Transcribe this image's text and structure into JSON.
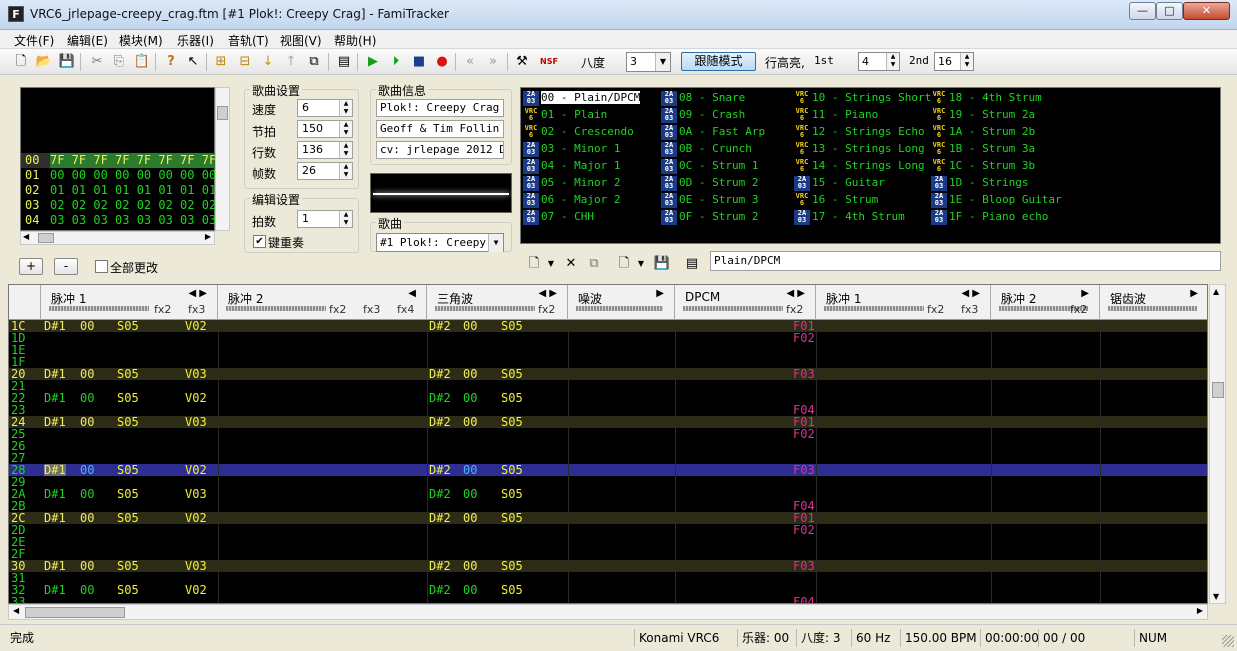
{
  "window": {
    "title": "VRC6_jrlepage-creepy_crag.ftm [#1 Plok!: Creepy Crag] - FamiTracker",
    "min_glyph": "—",
    "max_glyph": "□",
    "close_glyph": "✕"
  },
  "menu": [
    "文件(F)",
    "编辑(E)",
    "模块(M)",
    "乐器(I)",
    "音轨(T)",
    "视图(V)",
    "帮助(H)"
  ],
  "toolbar": {
    "octave_label": "八度",
    "octave_value": "3",
    "follow_label": "跟随模式",
    "row_highlight_label": "行高亮,",
    "first_label": "1st",
    "first_value": "4",
    "second_label": "2nd",
    "second_value": "16"
  },
  "frames": {
    "rows": [
      {
        "num": "00",
        "values": "7F 7F 7F 7F 7F 7F 7F 7F"
      },
      {
        "num": "01",
        "values": "00 00 00 00 00 00 00 00"
      },
      {
        "num": "02",
        "values": "01 01 01 01 01 01 01 01"
      },
      {
        "num": "03",
        "values": "02 02 02 02 02 02 02 02"
      },
      {
        "num": "04",
        "values": "03 03 03 03 03 03 03 03"
      }
    ],
    "add_label": "+",
    "remove_label": "-",
    "change_all_label": "全部更改"
  },
  "song_settings": {
    "title": "歌曲设置",
    "speed_label": "速度",
    "speed": "6",
    "tempo_label": "节拍",
    "tempo": "150",
    "rows_label": "行数",
    "rows": "136",
    "frames_label": "帧数",
    "frames": "26"
  },
  "edit_settings": {
    "title": "编辑设置",
    "step_label": "拍数",
    "step": "1",
    "key_repeat_label": "键重奏",
    "key_repeat_checked": true
  },
  "song_info": {
    "title": "歌曲信息",
    "name": "Plok!: Creepy Crag",
    "artist": "Geoff & Tim Follin",
    "copyright": "cv: jrlepage 2012 DC"
  },
  "song_select": {
    "label": "歌曲",
    "value": "#1 Plok!: Creepy"
  },
  "instruments": [
    {
      "badge": "2A03",
      "text": "00 - Plain/DPCM",
      "selected": true
    },
    {
      "badge": "VRC6",
      "text": "01 - Plain"
    },
    {
      "badge": "VRC6",
      "text": "02 - Crescendo"
    },
    {
      "badge": "2A03",
      "text": "03 - Minor 1"
    },
    {
      "badge": "2A03",
      "text": "04 - Major 1"
    },
    {
      "badge": "2A03",
      "text": "05 - Minor 2"
    },
    {
      "badge": "2A03",
      "text": "06 - Major 2"
    },
    {
      "badge": "2A03",
      "text": "07 - CHH"
    },
    {
      "badge": "2A03",
      "text": "08 - Snare"
    },
    {
      "badge": "2A03",
      "text": "09 - Crash"
    },
    {
      "badge": "2A03",
      "text": "0A - Fast Arp"
    },
    {
      "badge": "2A03",
      "text": "0B - Crunch"
    },
    {
      "badge": "2A03",
      "text": "0C - Strum 1"
    },
    {
      "badge": "2A03",
      "text": "0D - Strum 2"
    },
    {
      "badge": "2A03",
      "text": "0E - Strum 3"
    },
    {
      "badge": "2A03",
      "text": "0F - Strum 2"
    },
    {
      "badge": "VRC6",
      "text": "10 - Strings Short"
    },
    {
      "badge": "VRC6",
      "text": "11 - Piano"
    },
    {
      "badge": "VRC6",
      "text": "12 - Strings Echo"
    },
    {
      "badge": "VRC6",
      "text": "13 - Strings Long"
    },
    {
      "badge": "VRC6",
      "text": "14 - Strings Long"
    },
    {
      "badge": "2A03",
      "text": "15 - Guitar"
    },
    {
      "badge": "VRC6",
      "text": "16 - Strum"
    },
    {
      "badge": "2A03",
      "text": "17 - 4th Strum"
    },
    {
      "badge": "VRC6",
      "text": "18 - 4th Strum"
    },
    {
      "badge": "VRC6",
      "text": "19 - Strum 2a"
    },
    {
      "badge": "VRC6",
      "text": "1A - Strum 2b"
    },
    {
      "badge": "VRC6",
      "text": "1B - Strum 3a"
    },
    {
      "badge": "VRC6",
      "text": "1C - Strum 3b"
    },
    {
      "badge": "2A03",
      "text": "1D - Strings"
    },
    {
      "badge": "2A03",
      "text": "1E - Bloop Guitar"
    },
    {
      "badge": "2A03",
      "text": "1F - Piano echo"
    }
  ],
  "instrument_name": "Plain/DPCM",
  "channels": [
    {
      "name": "脉冲 1",
      "arrows": "◀ ▶",
      "fx": [
        "fx2",
        "fx3"
      ]
    },
    {
      "name": "脉冲 2",
      "arrows": "◀",
      "fx": [
        "fx2",
        "fx3",
        "fx4"
      ]
    },
    {
      "name": "三角波",
      "arrows": "◀ ▶",
      "fx": [
        "fx2"
      ]
    },
    {
      "name": "噪波",
      "arrows": "▶",
      "fx": []
    },
    {
      "name": "DPCM",
      "arrows": "◀ ▶",
      "fx": [
        "fx2"
      ]
    },
    {
      "name": "脉冲 1",
      "arrows": "◀ ▶",
      "fx": [
        "fx2",
        "fx3"
      ]
    },
    {
      "name": "脉冲 2",
      "arrows": "▶",
      "fx": [
        "fx2"
      ]
    },
    {
      "name": "锯齿波",
      "arrows": "▶",
      "fx": []
    }
  ],
  "pattern_rows": [
    {
      "num": "1C",
      "type": "hl",
      "p1note": "D#1",
      "p1inst": "00",
      "p1s": "S05",
      "p1v": "V02",
      "tnote": "D#2",
      "tinst": "00",
      "ts": "S05",
      "dpcm": "F01"
    },
    {
      "num": "1D",
      "dpcm": "F02"
    },
    {
      "num": "1E"
    },
    {
      "num": "1F"
    },
    {
      "num": "20",
      "type": "hl",
      "p1note": "D#1",
      "p1inst": "00",
      "p1s": "S05",
      "p1v": "V03",
      "tnote": "D#2",
      "tinst": "00",
      "ts": "S05",
      "dpcm": "F03"
    },
    {
      "num": "21"
    },
    {
      "num": "22",
      "p1note": "D#1",
      "p1inst": "00",
      "p1s": "S05",
      "p1v": "V02",
      "tnote": "D#2",
      "tinst": "00",
      "ts": "S05"
    },
    {
      "num": "23",
      "dpcm": "F04"
    },
    {
      "num": "24",
      "type": "hl",
      "p1note": "D#1",
      "p1inst": "00",
      "p1s": "S05",
      "p1v": "V03",
      "tnote": "D#2",
      "tinst": "00",
      "ts": "S05",
      "dpcm": "F01"
    },
    {
      "num": "25",
      "dpcm": "F02"
    },
    {
      "num": "26"
    },
    {
      "num": "27"
    },
    {
      "num": "28",
      "type": "cur",
      "p1note": "D#1",
      "p1inst": "00",
      "p1s": "S05",
      "p1v": "V02",
      "tnote": "D#2",
      "tinst": "00",
      "ts": "S05",
      "dpcm": "F03"
    },
    {
      "num": "29"
    },
    {
      "num": "2A",
      "p1note": "D#1",
      "p1inst": "00",
      "p1s": "S05",
      "p1v": "V03",
      "tnote": "D#2",
      "tinst": "00",
      "ts": "S05"
    },
    {
      "num": "2B",
      "dpcm": "F04"
    },
    {
      "num": "2C",
      "type": "hl",
      "p1note": "D#1",
      "p1inst": "00",
      "p1s": "S05",
      "p1v": "V02",
      "tnote": "D#2",
      "tinst": "00",
      "ts": "S05",
      "dpcm": "F01"
    },
    {
      "num": "2D",
      "dpcm": "F02"
    },
    {
      "num": "2E"
    },
    {
      "num": "2F"
    },
    {
      "num": "30",
      "type": "hl",
      "p1note": "D#1",
      "p1inst": "00",
      "p1s": "S05",
      "p1v": "V03",
      "tnote": "D#2",
      "tinst": "00",
      "ts": "S05",
      "dpcm": "F03"
    },
    {
      "num": "31"
    },
    {
      "num": "32",
      "p1note": "D#1",
      "p1inst": "00",
      "p1s": "S05",
      "p1v": "V02",
      "tnote": "D#2",
      "tinst": "00",
      "ts": "S05"
    },
    {
      "num": "33",
      "dpcm": "F04"
    }
  ],
  "status": {
    "message": "完成",
    "chip": "Konami VRC6",
    "instrument": "乐器: 00",
    "octave": "八度: 3",
    "rate": "60 Hz",
    "bpm": "150.00 BPM",
    "time": "00:00:00",
    "position": "00 / 00",
    "numlock": "NUM"
  }
}
